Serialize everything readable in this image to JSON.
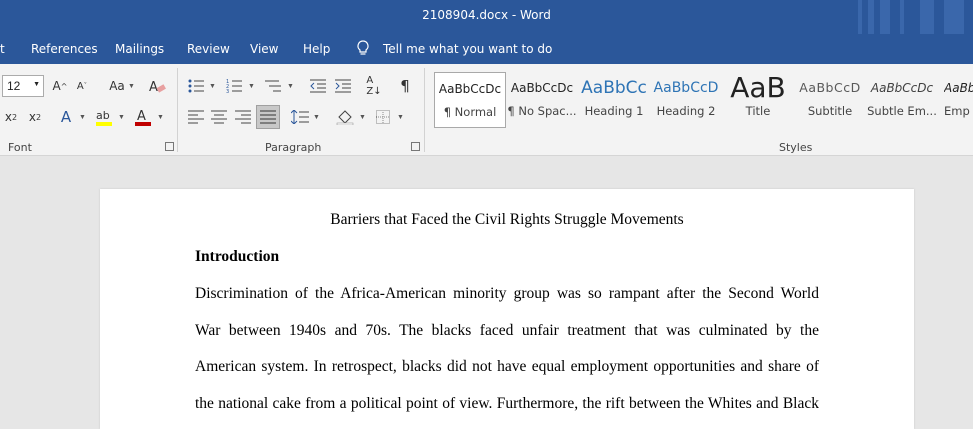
{
  "window": {
    "title": "2108904.docx  -  Word"
  },
  "menu": [
    "t",
    "References",
    "Mailings",
    "Review",
    "View",
    "Help"
  ],
  "tell_me": "Tell me what you want to do",
  "font": {
    "size": "12",
    "group_label": "Font"
  },
  "paragraph": {
    "group_label": "Paragraph"
  },
  "styles": {
    "group_label": "Styles",
    "items": [
      {
        "preview": "AaBbCcDc",
        "name": "¶ Normal"
      },
      {
        "preview": "AaBbCcDc",
        "name": "¶ No Spac..."
      },
      {
        "preview": "AaBbCc",
        "name": "Heading 1"
      },
      {
        "preview": "AaBbCcD",
        "name": "Heading 2"
      },
      {
        "preview": "AaB",
        "name": "Title"
      },
      {
        "preview": "AaBbCcD",
        "name": "Subtitle"
      },
      {
        "preview": "AaBbCcDc",
        "name": "Subtle Em..."
      },
      {
        "preview": "AaBb",
        "name": "Emp"
      }
    ]
  },
  "colors": {
    "brand": "#2b579a",
    "font_color": "#c00000",
    "highlight": "#ffff00"
  },
  "document": {
    "title": "Barriers that Faced the Civil Rights Struggle Movements",
    "heading": "Introduction",
    "lines": [
      "Discrimination of the Africa-American minority group was so rampant after the Second World",
      "War between 1940s and 70s. The blacks faced unfair treatment that was culminated by the",
      "American system. In retrospect, blacks did not have equal employment opportunities and share of",
      "the national cake from a political point of view. Furthermore, the rift between the Whites and Black"
    ]
  }
}
